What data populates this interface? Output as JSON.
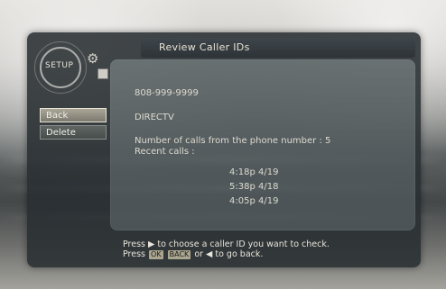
{
  "screen": {
    "title": "Review Caller IDs",
    "logo_text": "SETUP",
    "menu": {
      "items": [
        {
          "label": "Back",
          "selected": true
        },
        {
          "label": "Delete",
          "selected": false
        }
      ]
    },
    "details": {
      "phone_number": "808-999-9999",
      "caller_name": "DIRECTV",
      "calls_line": "Number of calls from the phone number : 5",
      "recent_label": "Recent calls :",
      "recent_calls": [
        "4:18p 4/19",
        "5:38p 4/18",
        "4:05p 4/19"
      ]
    },
    "help": {
      "line1": "Press ▶ to choose a caller ID you want to check.",
      "line2_prefix": "Press",
      "key_ok": "OK",
      "key_back": "BACK",
      "line2_suffix": "or ◀ to go back."
    }
  },
  "icons": [
    "settings-gear-icon",
    "document-icon"
  ],
  "colors": {
    "panel_bg": "#282e31",
    "text": "#dedbd0",
    "selected_button": "#a9a697",
    "button": "#5f6663"
  }
}
